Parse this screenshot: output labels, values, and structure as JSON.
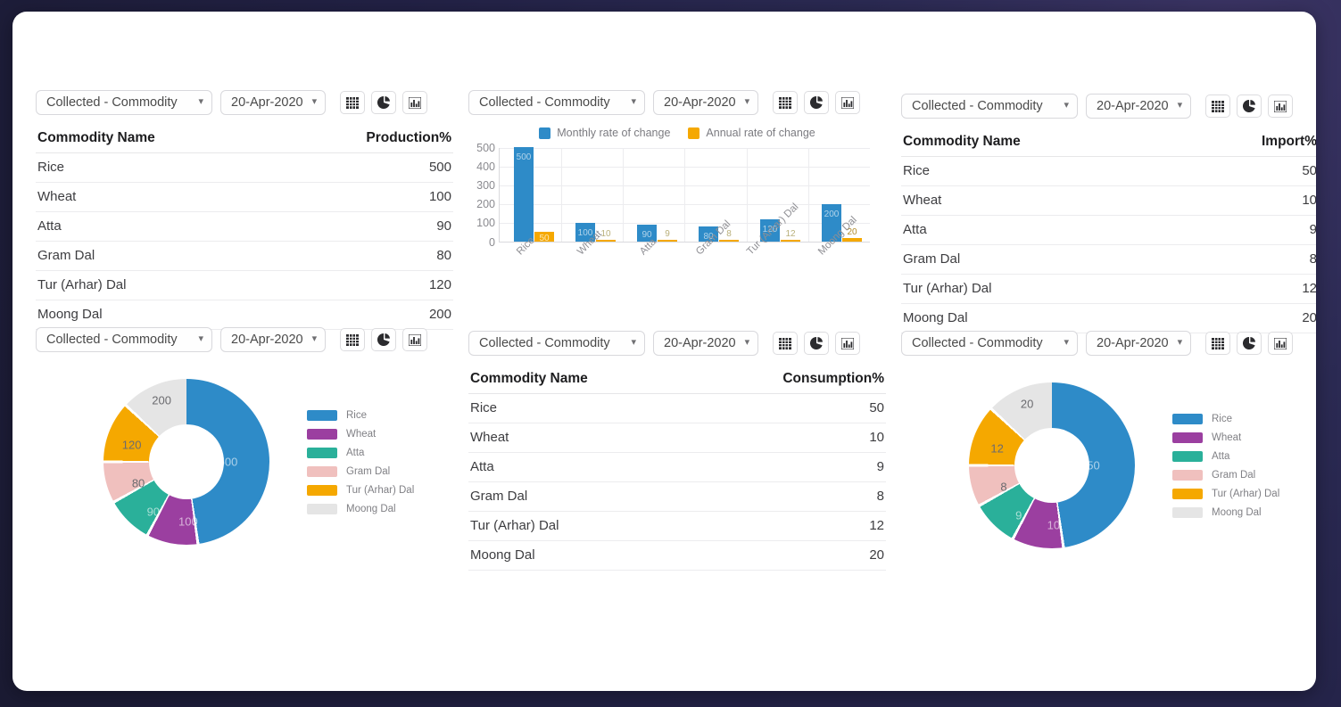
{
  "theme": {
    "page_bg": "#272650",
    "card_bg": "#ffffff",
    "series_blue": "#2E8BC8",
    "series_orange": "#F5A800"
  },
  "commodities": [
    "Rice",
    "Wheat",
    "Atta",
    "Gram Dal",
    "Tur (Arhar) Dal",
    "Moong Dal"
  ],
  "palette": [
    "#2E8BC8",
    "#9B3FA0",
    "#2AB09A",
    "#F0C0BE",
    "#F5A800",
    "#E5E5E5"
  ],
  "toolbar": {
    "commodity_select": "Collected - Commodity",
    "date_select": "20-Apr-2020",
    "chevron": "⌄",
    "grid_icon": "grid-view-icon",
    "pie_icon": "pie-view-icon",
    "bar_icon": "bar-view-icon"
  },
  "panels": {
    "production_table": {
      "headers": [
        "Commodity Name",
        "Production%"
      ],
      "rows": [
        {
          "name": "Rice",
          "value": "500"
        },
        {
          "name": "Wheat",
          "value": "100"
        },
        {
          "name": "Atta",
          "value": "90"
        },
        {
          "name": "Gram Dal",
          "value": "80"
        },
        {
          "name": "Tur (Arhar) Dal",
          "value": "120"
        },
        {
          "name": "Moong Dal",
          "value": "200"
        }
      ]
    },
    "import_table": {
      "headers": [
        "Commodity Name",
        "Import%"
      ],
      "rows": [
        {
          "name": "Rice",
          "value": "50"
        },
        {
          "name": "Wheat",
          "value": "10"
        },
        {
          "name": "Atta",
          "value": "9"
        },
        {
          "name": "Gram Dal",
          "value": "8"
        },
        {
          "name": "Tur (Arhar) Dal",
          "value": "12"
        },
        {
          "name": "Moong Dal",
          "value": "20"
        }
      ]
    },
    "consumption_table": {
      "headers": [
        "Commodity Name",
        "Consumption%"
      ],
      "rows": [
        {
          "name": "Rice",
          "value": "50"
        },
        {
          "name": "Wheat",
          "value": "10"
        },
        {
          "name": "Atta",
          "value": "9"
        },
        {
          "name": "Gram Dal",
          "value": "8"
        },
        {
          "name": "Tur (Arhar) Dal",
          "value": "12"
        },
        {
          "name": "Moong Dal",
          "value": "20"
        }
      ]
    }
  },
  "chart_data": [
    {
      "id": "rate-of-change-bar",
      "type": "bar",
      "title": "",
      "xlabel": "",
      "ylabel": "",
      "categories": [
        "Rice",
        "Wheat",
        "Atta",
        "Gram Dal",
        "Tur (Arhar) Dal",
        "Moong Dal"
      ],
      "series": [
        {
          "name": "Monthly rate of change",
          "color": "#2E8BC8",
          "values": [
            500,
            100,
            90,
            80,
            120,
            200
          ]
        },
        {
          "name": "Annual rate of change",
          "color": "#F5A800",
          "values": [
            50,
            10,
            9,
            8,
            12,
            20
          ]
        }
      ],
      "ylim": [
        0,
        500
      ],
      "yticks": [
        "500",
        "400",
        "300",
        "200",
        "100",
        "0"
      ],
      "grid": true,
      "legend_position": "top"
    },
    {
      "id": "production-donut",
      "type": "pie",
      "title": "",
      "labels": [
        "Rice",
        "Wheat",
        "Atta",
        "Gram Dal",
        "Tur (Arhar) Dal",
        "Moong Dal"
      ],
      "values": [
        500,
        100,
        90,
        80,
        120,
        200
      ],
      "colors": [
        "#2E8BC8",
        "#9B3FA0",
        "#2AB09A",
        "#F0C0BE",
        "#F5A800",
        "#E5E5E5"
      ],
      "legend_position": "right",
      "donut": true
    },
    {
      "id": "import-donut",
      "type": "pie",
      "title": "",
      "labels": [
        "Rice",
        "Wheat",
        "Atta",
        "Gram Dal",
        "Tur (Arhar) Dal",
        "Moong Dal"
      ],
      "values": [
        50,
        10,
        9,
        8,
        12,
        20
      ],
      "colors": [
        "#2E8BC8",
        "#9B3FA0",
        "#2AB09A",
        "#F0C0BE",
        "#F5A800",
        "#E5E5E5"
      ],
      "legend_position": "right",
      "donut": true
    }
  ]
}
